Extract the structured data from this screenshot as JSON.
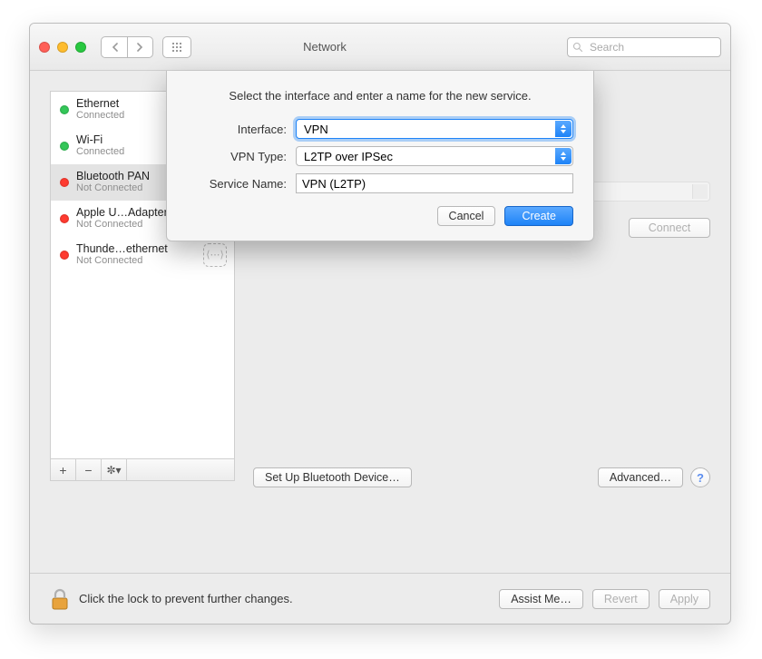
{
  "window": {
    "title": "Network"
  },
  "toolbar": {
    "search_placeholder": "Search"
  },
  "sidebar": {
    "items": [
      {
        "name": "Ethernet",
        "status_text": "Connected",
        "status": "green",
        "icon": "ethernet"
      },
      {
        "name": "Wi-Fi",
        "status_text": "Connected",
        "status": "green",
        "icon": "wifi"
      },
      {
        "name": "Bluetooth PAN",
        "status_text": "Not Connected",
        "status": "red",
        "icon": "bluetooth"
      },
      {
        "name": "Apple U…Adapter",
        "status_text": "Not Connected",
        "status": "red",
        "icon": "ethernet"
      },
      {
        "name": "Thunde…ethernet",
        "status_text": "Not Connected",
        "status": "red",
        "icon": "ethernet"
      }
    ],
    "selected_index": 2
  },
  "detail": {
    "connect_label": "Connect",
    "setup_label": "Set Up Bluetooth Device…",
    "advanced_label": "Advanced…"
  },
  "footer": {
    "lock_text": "Click the lock to prevent further changes.",
    "assist_label": "Assist Me…",
    "revert_label": "Revert",
    "apply_label": "Apply"
  },
  "sheet": {
    "title": "Select the interface and enter a name for the new service.",
    "labels": {
      "interface": "Interface:",
      "vpn_type": "VPN Type:",
      "service_name": "Service Name:"
    },
    "values": {
      "interface": "VPN",
      "vpn_type": "L2TP over IPSec",
      "service_name": "VPN (L2TP)"
    },
    "cancel_label": "Cancel",
    "create_label": "Create"
  }
}
